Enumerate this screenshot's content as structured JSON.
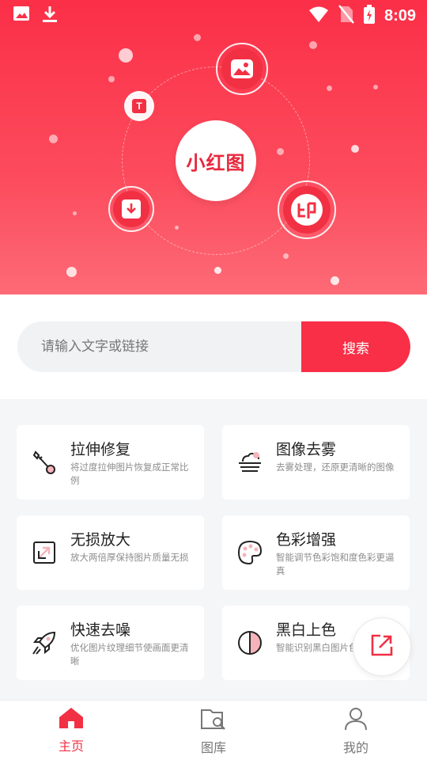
{
  "status_bar": {
    "time": "8:09"
  },
  "hero": {
    "logo_text": "小红图"
  },
  "search": {
    "placeholder": "请输入文字或链接",
    "button_label": "搜索"
  },
  "features": [
    {
      "title": "拉伸修复",
      "desc": "将过度拉伸图片恢复成正常比例",
      "icon": "wrench-icon"
    },
    {
      "title": "图像去雾",
      "desc": "去雾处理，还原更清晰的图像",
      "icon": "fog-icon"
    },
    {
      "title": "无损放大",
      "desc": "放大两倍厚保持图片质量无损",
      "icon": "enlarge-icon"
    },
    {
      "title": "色彩增强",
      "desc": "智能调节色彩饱和度色彩更逼真",
      "icon": "palette-icon"
    },
    {
      "title": "快速去噪",
      "desc": "优化图片纹理细节使画面更清晰",
      "icon": "rocket-icon"
    },
    {
      "title": "黑白上色",
      "desc": "智能识别黑白图片色彩填充",
      "icon": "half-circle-icon"
    }
  ],
  "nav": [
    {
      "label": "主页",
      "icon": "home-icon",
      "active": true
    },
    {
      "label": "图库",
      "icon": "gallery-folder-icon",
      "active": false
    },
    {
      "label": "我的",
      "icon": "profile-icon",
      "active": false
    }
  ],
  "colors": {
    "accent": "#f92f47",
    "text": "#222222",
    "muted": "#8c8c8c"
  }
}
